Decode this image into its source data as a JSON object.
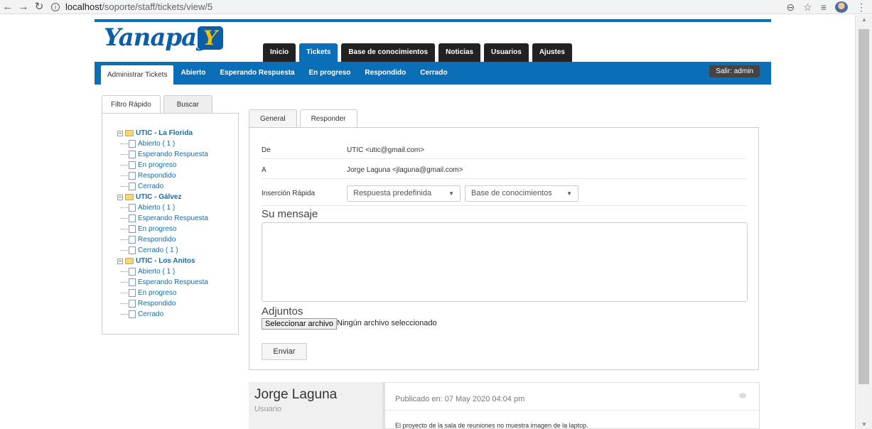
{
  "browser": {
    "url_host": "localhost",
    "url_path": "/soporte/staff/tickets/view/5"
  },
  "brand": {
    "name": "Yanapay",
    "mark": "Y"
  },
  "main_tabs": [
    "Inicio",
    "Tickets",
    "Base de conocimientos",
    "Noticias",
    "Usuarios",
    "Ajustes"
  ],
  "sub_nav": {
    "items": [
      "Administrar Tickets",
      "Abierto",
      "Esperando Respuesta",
      "En progreso",
      "Respondido",
      "Cerrado"
    ],
    "logout": "Salir: admin"
  },
  "side_tabs": [
    "Filtro Rápido",
    "Buscar"
  ],
  "tree": [
    {
      "name": "UTIC - La Florida",
      "items": [
        "Abierto ( 1 )",
        "Esperando Respuesta",
        "En progreso",
        "Respondido",
        "Cerrado"
      ]
    },
    {
      "name": "UTIC - Gálvez",
      "items": [
        "Abierto ( 1 )",
        "Esperando Respuesta",
        "En progreso",
        "Respondido",
        "Cerrado ( 1 )"
      ]
    },
    {
      "name": "UTIC - Los Anitos",
      "items": [
        "Abierto ( 1 )",
        "Esperando Respuesta",
        "En progreso",
        "Respondido",
        "Cerrado"
      ]
    }
  ],
  "content_tabs": [
    "General",
    "Responder"
  ],
  "form": {
    "from_label": "De",
    "from_value": "UTIC <utic@gmail.com>",
    "to_label": "A",
    "to_value": "Jorge Laguna <jlaguna@gmail.com>",
    "quick_label": "Inserción Rápida",
    "select_predefined": "Respuesta predefinida",
    "select_kb": "Base de conocimientos",
    "message_title": "Su mensaje",
    "attachments_title": "Adjuntos",
    "file_button": "Seleccionar archivo",
    "file_status": "Ningún archivo seleccionado",
    "send": "Enviar"
  },
  "post": {
    "author": "Jorge Laguna",
    "role": "Usuario",
    "date": "Publicado en: 07 May 2020 04:04 pm",
    "text": "El proyecto de la sala de reuniones no muestra imagen de la laptop."
  },
  "colors": {
    "primary": "#0b6fb8",
    "dark_tab": "#222222",
    "logo": "#0b5ea8",
    "logo_accent": "#f5c200"
  }
}
